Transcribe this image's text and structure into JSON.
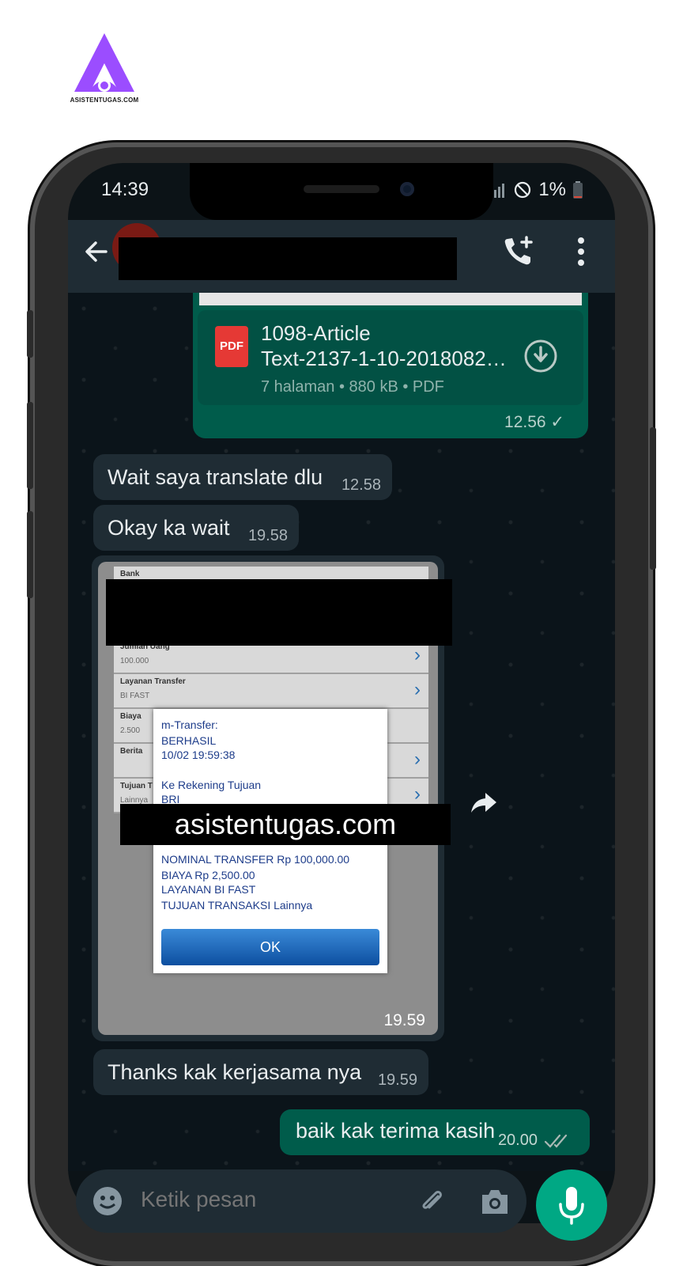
{
  "brand": {
    "site_label": "ASISTENTUGAS.COM",
    "color": "#9b4dff"
  },
  "status_bar": {
    "time": "14:39",
    "battery": "1%"
  },
  "chat_header": {
    "back_icon": "arrow-left-icon",
    "call_icon": "add-call-icon",
    "menu_icon": "more-vert-icon"
  },
  "messages": {
    "pdf": {
      "name_line1": "1098-Article",
      "name_line2": "Text-2137-1-10-2018082…",
      "meta": "7 halaman • 880 kB • PDF",
      "icon_label": "PDF",
      "time": "12.56 ✓"
    },
    "in1": {
      "text": "Wait saya translate dlu",
      "time": "12.58"
    },
    "in2": {
      "text": "Okay ka wait",
      "time": "19.58"
    },
    "image": {
      "rows": [
        {
          "label": "Bank",
          "sub": ""
        },
        {
          "label": "Jumlah Uang",
          "sub": "100.000"
        },
        {
          "label": "Layanan Transfer",
          "sub": "BI FAST"
        },
        {
          "label": "Biaya",
          "sub": "2.500"
        },
        {
          "label": "Berita",
          "sub": ""
        },
        {
          "label": "Tujuan T",
          "sub": "Lainnya"
        }
      ],
      "dialog": {
        "l1": "m-Transfer:",
        "l2": "BERHASIL",
        "l3": "10/02 19:59:38",
        "l4": "Ke Rekening Tujuan",
        "l5": "BRI",
        "l6": "NOMINAL TRANSFER Rp 100,000.00",
        "l7": "BIAYA Rp 2,500.00",
        "l8": "LAYANAN BI FAST",
        "l9": "TUJUAN TRANSAKSI Lainnya",
        "ok": "OK"
      },
      "watermark": "asistentugas.com",
      "time": "19.59"
    },
    "in3": {
      "text": "Thanks kak kerjasama nya",
      "time": "19.59"
    },
    "out1": {
      "text": "baik kak terima kasih",
      "time": "20.00"
    }
  },
  "composer": {
    "placeholder": "Ketik pesan"
  }
}
